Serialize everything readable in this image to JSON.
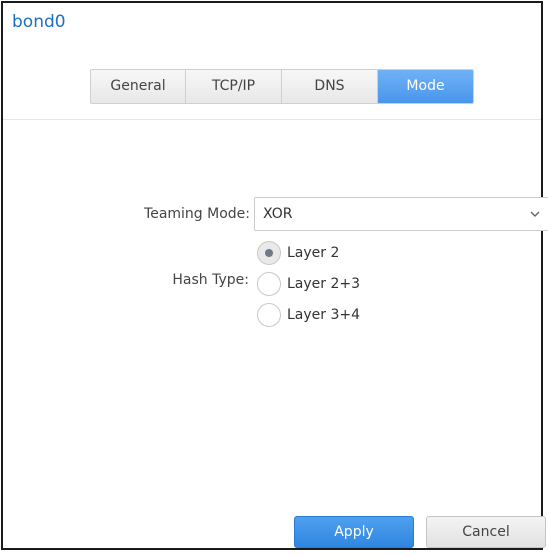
{
  "window": {
    "title": "bond0"
  },
  "tabs": [
    {
      "label": "General",
      "active": false
    },
    {
      "label": "TCP/IP",
      "active": false
    },
    {
      "label": "DNS",
      "active": false
    },
    {
      "label": "Mode",
      "active": true
    }
  ],
  "form": {
    "teaming_mode": {
      "label": "Teaming Mode:",
      "value": "XOR"
    },
    "hash_type": {
      "label": "Hash Type:",
      "options": [
        {
          "label": "Layer 2",
          "checked": true
        },
        {
          "label": "Layer 2+3",
          "checked": false
        },
        {
          "label": "Layer 3+4",
          "checked": false
        }
      ]
    }
  },
  "actions": {
    "apply_label": "Apply",
    "cancel_label": "Cancel"
  },
  "colors": {
    "title": "#1d6fc4",
    "active_tab": "#4a96ec",
    "apply_button": "#2f86e0",
    "radio_dot": "#6d7a8a"
  },
  "icons": {
    "select_chevron": "chevron-down-icon"
  }
}
